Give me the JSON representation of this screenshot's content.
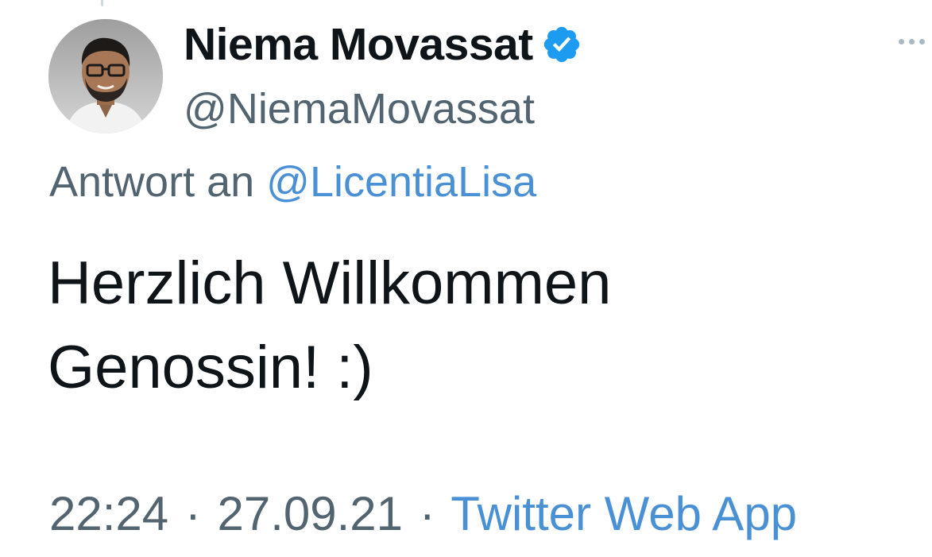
{
  "tweet": {
    "author": {
      "display_name": "Niema Movassat",
      "handle": "@NiemaMovassat",
      "verified": true,
      "verified_icon": "verified-badge-icon",
      "avatar_icon": "profile-avatar"
    },
    "more_icon": "more-options-icon",
    "reply": {
      "prefix": "Antwort an ",
      "target": "@LicentiaLisa"
    },
    "text_lines": [
      "Herzlich Willkommen",
      "Genossin! :)"
    ],
    "time": "22:24",
    "separator": "·",
    "date": "27.09.21",
    "source": "Twitter Web App"
  },
  "colors": {
    "accent": "#4a90d4",
    "verified": "#1d9bf0",
    "secondary_text": "#536471",
    "primary_text": "#0f1419"
  }
}
